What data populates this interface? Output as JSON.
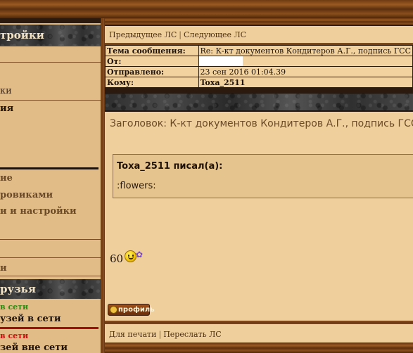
{
  "sidebar": {
    "header1": "тройки",
    "header2": "рузья",
    "rows": {
      "r1": "ки",
      "r2": "ия",
      "r3": "ие",
      "r4": "ровиками",
      "r5": "и и настройки",
      "r6": "и",
      "r7": "в сети",
      "r8": "узей в сети",
      "r9": "в сети",
      "r10": "зей вне сети"
    },
    "colors": {
      "online": "#2f8a12",
      "offline": "#d01010"
    }
  },
  "nav_top": {
    "prev": "Предыдущее ЛС",
    "separator": "|",
    "next": "Следующее ЛС"
  },
  "message": {
    "subject_label": "Тема сообщения:",
    "subject_value": "Re: К-кт документов Кондитеров А.Г., подпись ГСС",
    "from_label": "От:",
    "from_value": "",
    "sent_label": "Отправлено:",
    "sent_value": "23 сен 2016 01:04.39",
    "to_label": "Кому:",
    "to_value": "Toxa_2511",
    "title": "Заголовок: К-кт документов Кондитеров А.Г., подпись ГСС",
    "quote_author": "Toxa_2511 писал(а):",
    "quote_text": ":flowers:",
    "body_number": "60"
  },
  "buttons": {
    "profile": "профиль"
  },
  "nav_bottom": {
    "print": "Для печати",
    "separator": "|",
    "forward": "Переслать ЛС"
  },
  "icons": [
    "smiley-icon",
    "flower-icon",
    "profile-icon"
  ]
}
